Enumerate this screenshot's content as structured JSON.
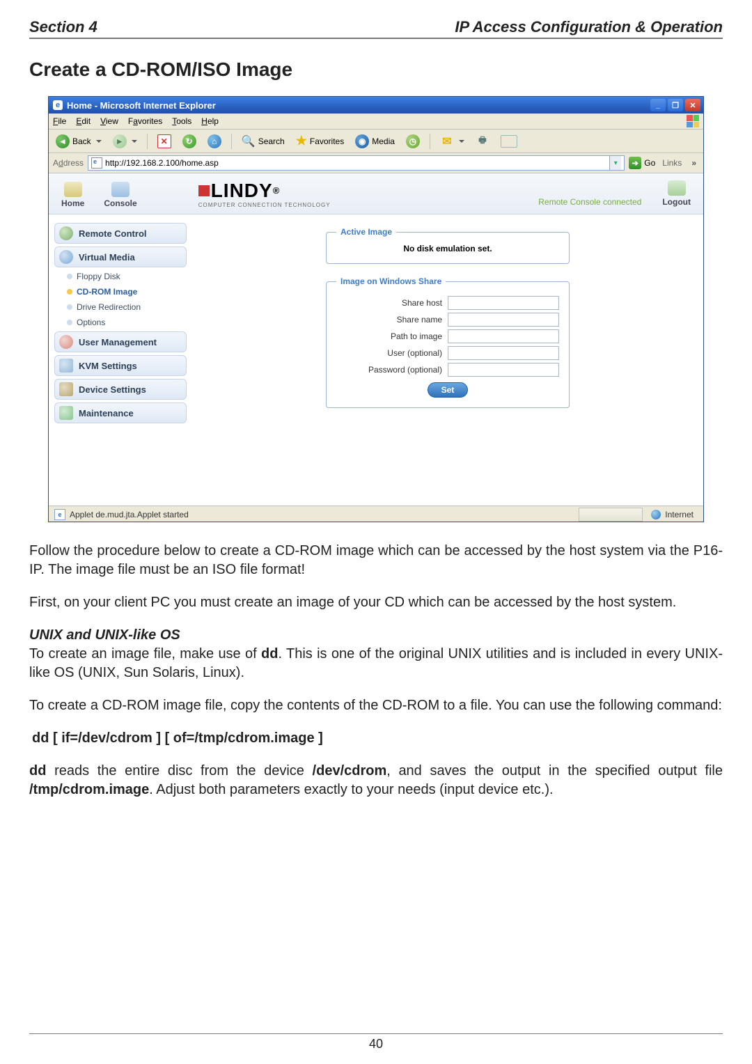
{
  "doc": {
    "section_left": "Section 4",
    "section_right": "IP Access Configuration & Operation",
    "title": "Create a CD-ROM/ISO Image",
    "page_number": "40"
  },
  "ie": {
    "window_title": "Home - Microsoft Internet Explorer",
    "menus": {
      "file": "File",
      "edit": "Edit",
      "view": "View",
      "favorites": "Favorites",
      "tools": "Tools",
      "help": "Help"
    },
    "toolbar": {
      "back": "Back",
      "search": "Search",
      "favorites": "Favorites",
      "media": "Media"
    },
    "address_label": "Address",
    "address_value": "http://192.168.2.100/home.asp",
    "go": "Go",
    "links": "Links",
    "status_text": "Applet de.mud.jta.Applet started",
    "zone": "Internet"
  },
  "app": {
    "header": {
      "home": "Home",
      "console": "Console",
      "brand": "LINDY",
      "brand_tag": "COMPUTER CONNECTION TECHNOLOGY",
      "status": "Remote Console connected",
      "logout": "Logout"
    },
    "sidebar": {
      "remote_control": "Remote Control",
      "virtual_media": "Virtual Media",
      "floppy_disk": "Floppy Disk",
      "cdrom_image": "CD-ROM Image",
      "drive_redirection": "Drive Redirection",
      "options": "Options",
      "user_management": "User Management",
      "kvm_settings": "KVM Settings",
      "device_settings": "Device Settings",
      "maintenance": "Maintenance"
    },
    "content": {
      "active_image_legend": "Active Image",
      "no_emulation": "No disk emulation set.",
      "windows_share_legend": "Image on Windows Share",
      "labels": {
        "share_host": "Share host",
        "share_name": "Share name",
        "path_to_image": "Path to image",
        "user_optional": "User (optional)",
        "password_optional": "Password (optional)"
      },
      "values": {
        "share_host": "",
        "share_name": "",
        "path_to_image": "",
        "user_optional": "",
        "password_optional": ""
      },
      "set_button": "Set"
    }
  },
  "body": {
    "p1": "Follow the procedure below to create a CD-ROM image which can be accessed by the host system via the P16-IP. The image file must be an ISO file format!",
    "p2": "First, on your client PC you must create an image of your CD which can be accessed by the host system.",
    "h1": "UNIX and UNIX-like OS",
    "p3a": "To create an image file, make use of ",
    "p3b": "dd",
    "p3c": ". This is one of the original UNIX utilities and is included in every UNIX-like OS (UNIX, Sun Solaris, Linux).",
    "p4": "To create a CD-ROM image file, copy the contents of the CD-ROM to a file. You can use the following command:",
    "cmd": "dd [ if=/dev/cdrom ] [ of=/tmp/cdrom.image ]",
    "p5a": "dd",
    "p5b": " reads the entire disc from the device ",
    "p5c": "/dev/cdrom",
    "p5d": ", and saves the output in the specified output file ",
    "p5e": "/tmp/cdrom.image",
    "p5f": ". Adjust both parameters exactly to your needs (input device etc.)."
  }
}
